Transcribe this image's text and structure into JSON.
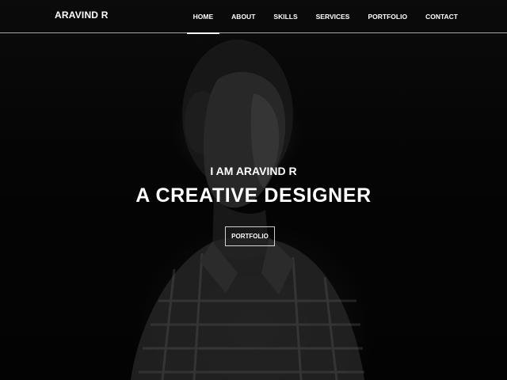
{
  "header": {
    "brand": "ARAVIND R",
    "nav": [
      {
        "label": "HOME",
        "active": true
      },
      {
        "label": "ABOUT",
        "active": false
      },
      {
        "label": "SKILLS",
        "active": false
      },
      {
        "label": "SERVICES",
        "active": false
      },
      {
        "label": "PORTFOLIO",
        "active": false
      },
      {
        "label": "CONTACT",
        "active": false
      }
    ]
  },
  "hero": {
    "subtitle": "I AM ARAVIND R",
    "title": "A CREATIVE DESIGNER",
    "cta_label": "PORTFOLIO",
    "background_image": "dark-portrait-photo"
  },
  "colors": {
    "background": "#000000",
    "text": "#ffffff"
  }
}
